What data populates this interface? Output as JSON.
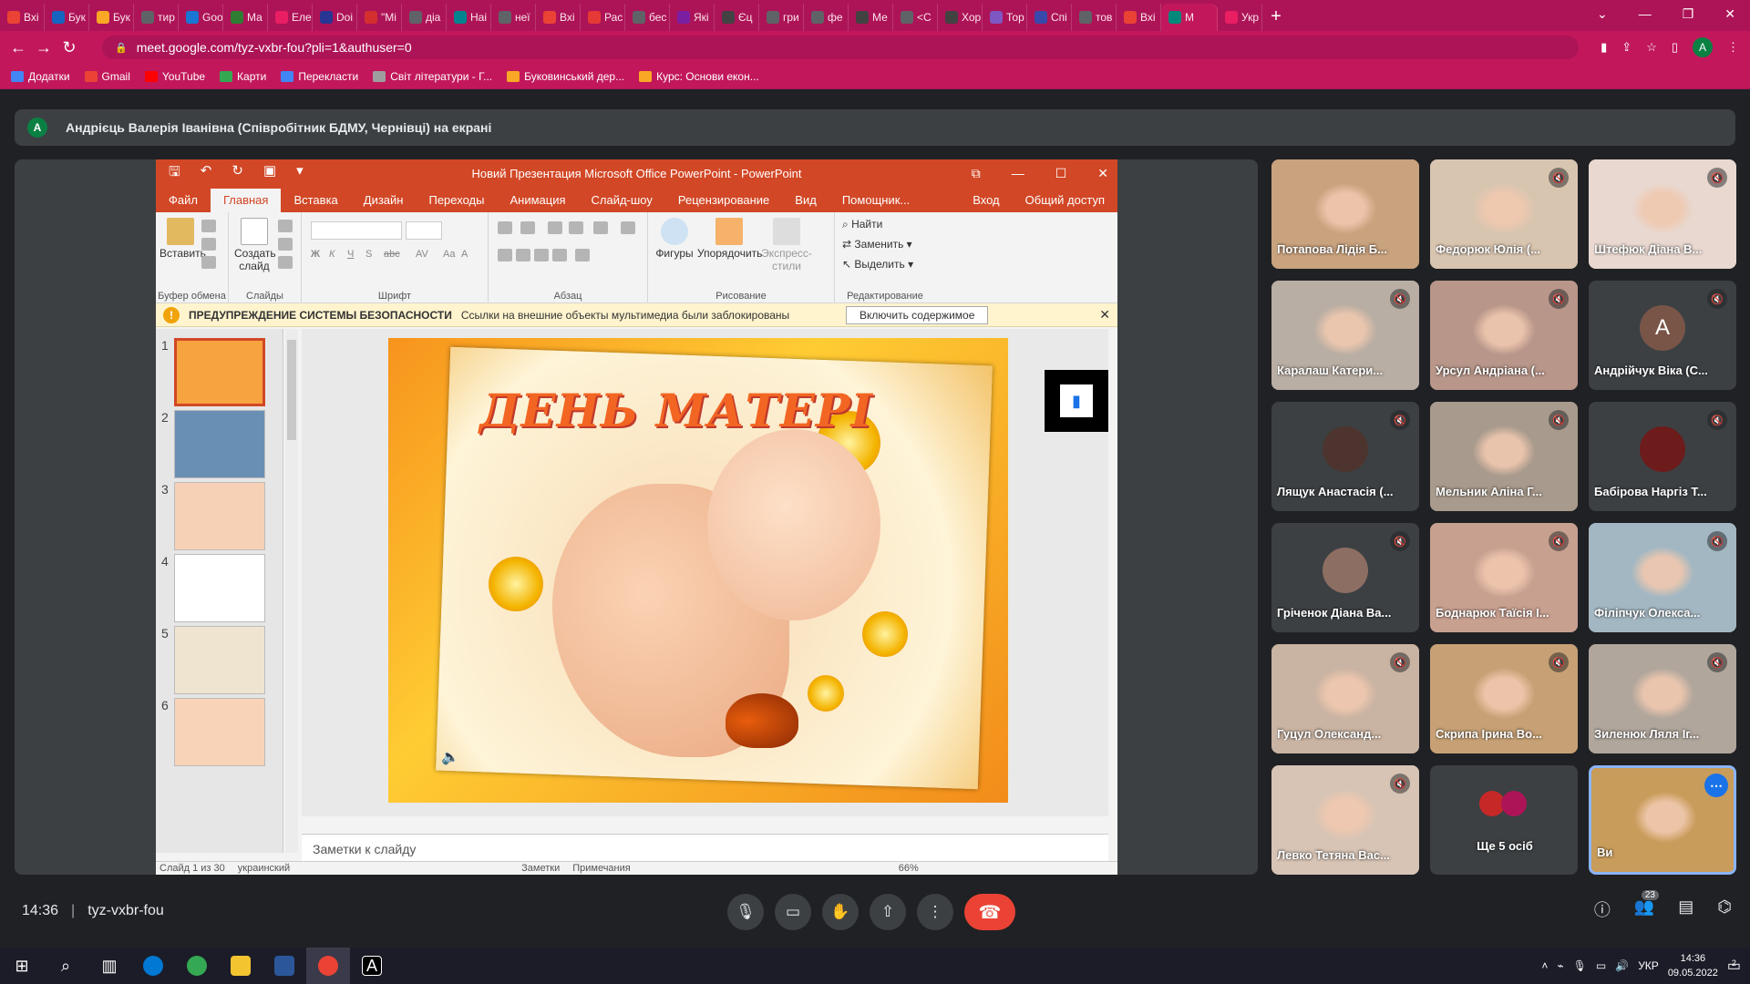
{
  "browser": {
    "tabs": [
      {
        "label": "Вхі",
        "color": "#ea4335"
      },
      {
        "label": "Бук",
        "color": "#1565c0"
      },
      {
        "label": "Бук",
        "color": "#f9a825"
      },
      {
        "label": "тир",
        "color": "#5f6368"
      },
      {
        "label": "Goo",
        "color": "#1976d2"
      },
      {
        "label": "Ма",
        "color": "#2e7d32"
      },
      {
        "label": "Еле",
        "color": "#e91e63"
      },
      {
        "label": "Doi",
        "color": "#283593"
      },
      {
        "label": "\"Мі",
        "color": "#d32f2f"
      },
      {
        "label": "діа",
        "color": "#5f6368"
      },
      {
        "label": "Наі",
        "color": "#00838f"
      },
      {
        "label": "неї",
        "color": "#5f6368"
      },
      {
        "label": "Вхі",
        "color": "#ea4335"
      },
      {
        "label": "Рас",
        "color": "#e53935"
      },
      {
        "label": "бес",
        "color": "#5f6368"
      },
      {
        "label": "Які",
        "color": "#7b1fa2"
      },
      {
        "label": "Єц",
        "color": "#424242"
      },
      {
        "label": "гри",
        "color": "#5f6368"
      },
      {
        "label": "фе",
        "color": "#5f6368"
      },
      {
        "label": "Ме",
        "color": "#424242"
      },
      {
        "label": "<С",
        "color": "#5f6368"
      },
      {
        "label": "Хор",
        "color": "#424242"
      },
      {
        "label": "Тор",
        "color": "#7e57c2"
      },
      {
        "label": "Спі",
        "color": "#3949ab"
      },
      {
        "label": "тов",
        "color": "#5f6368"
      },
      {
        "label": "Вхі",
        "color": "#ea4335"
      },
      {
        "label": "M",
        "color": "#00897b"
      },
      {
        "label": "Укр",
        "color": "#e91e63"
      }
    ],
    "new_tab": "+",
    "url": "meet.google.com/tyz-vxbr-fou?pli=1&authuser=0",
    "profile_initial": "A",
    "bookmarks": [
      {
        "label": "Додатки",
        "color": "#4285f4"
      },
      {
        "label": "Gmail",
        "color": "#ea4335"
      },
      {
        "label": "YouTube",
        "color": "#ff0000"
      },
      {
        "label": "Карти",
        "color": "#34a853"
      },
      {
        "label": "Перекласти",
        "color": "#4285f4"
      },
      {
        "label": "Світ літератури - Г...",
        "color": "#9e9e9e"
      },
      {
        "label": "Буковинський дер...",
        "color": "#f9a825"
      },
      {
        "label": "Курс: Основи екон...",
        "color": "#f9a825"
      }
    ]
  },
  "meet": {
    "presenter_initial": "A",
    "presenter_banner": "Андрієць Валерія Іванівна (Співробітник БДМУ, Чернівці) на екрані",
    "time": "14:36",
    "meeting_code": "tyz-vxbr-fou",
    "participant_count": "23",
    "participants": [
      {
        "name": "Потапова Лідія Б...",
        "bg": "#c9a27e",
        "muted": false
      },
      {
        "name": "Федорюк Юлія (...",
        "bg": "#d8c5b0",
        "muted": true
      },
      {
        "name": "Штефюк Діана В...",
        "bg": "#e8d8d0",
        "muted": true
      },
      {
        "name": "Каралаш Катери...",
        "bg": "#b9aea3",
        "muted": true
      },
      {
        "name": "Урсул Андріана (...",
        "bg": "#b8968a",
        "muted": true
      },
      {
        "name": "Андрійчук Віка (С...",
        "bg": "#3c4043",
        "muted": true,
        "initial": "A"
      },
      {
        "name": "Лящук Анастасія (...",
        "bg": "#3c4043",
        "muted": true,
        "avatar": "#4e342e"
      },
      {
        "name": "Мельник Аліна Г...",
        "bg": "#a89a8c",
        "muted": true
      },
      {
        "name": "Бабірова Наргіз Т...",
        "bg": "#3c4043",
        "muted": true,
        "avatar": "#6d1b1b"
      },
      {
        "name": "Гріченок Діана Ва...",
        "bg": "#3c4043",
        "muted": true,
        "avatar": "#8d6e63"
      },
      {
        "name": "Боднарюк Таїсія І...",
        "bg": "#c8a090",
        "muted": true
      },
      {
        "name": "Філіпчук Олекса...",
        "bg": "#a3b7c2",
        "muted": true
      },
      {
        "name": "Гуцул Олександ...",
        "bg": "#c9b3a2",
        "muted": true
      },
      {
        "name": "Скрипа Ірина Во...",
        "bg": "#c7a175",
        "muted": true
      },
      {
        "name": "Зиленюк Ляля Іг...",
        "bg": "#b0a69c",
        "muted": true
      },
      {
        "name": "Левко Тетяна Вас...",
        "bg": "#d7c4b5",
        "muted": true
      },
      {
        "name": "Ще 5 осіб",
        "bg": "#3c4043",
        "muted": false,
        "others": true
      },
      {
        "name": "Ви",
        "bg": "#c89c5a",
        "muted": false,
        "self": true
      }
    ]
  },
  "ppt": {
    "title": "Новий Презентация Microsoft Office PowerPoint - PowerPoint",
    "menu": [
      "Файл",
      "Главная",
      "Вставка",
      "Дизайн",
      "Переходы",
      "Анимация",
      "Слайд-шоу",
      "Рецензирование",
      "Вид",
      "Помощник...",
      "Вход",
      "Общий доступ"
    ],
    "groups": {
      "clipboard": "Буфер обмена",
      "slides": "Слайды",
      "font": "Шрифт",
      "paragraph": "Абзац",
      "drawing": "Рисование",
      "editing": "Редактирование"
    },
    "buttons": {
      "paste": "Вставить",
      "new_slide": "Создать слайд",
      "shapes": "Фигуры",
      "arrange": "Упорядочить",
      "quick_styles": "Экспресс-стили",
      "find": "Найти",
      "replace": "Заменить",
      "select": "Выделить"
    },
    "security": {
      "title": "ПРЕДУПРЕЖДЕНИЕ СИСТЕМЫ БЕЗОПАСНОСТИ",
      "message": "Ссылки на внешние объекты мультимедиа были заблокированы",
      "enable": "Включить содержимое"
    },
    "slide_title": "ДЕНЬ МАТЕРІ",
    "slide_numbers": [
      "1",
      "2",
      "3",
      "4",
      "5",
      "6"
    ],
    "notes_placeholder": "Заметки к слайду",
    "status": {
      "slide": "Слайд 1 из 30",
      "lang": "украинский",
      "notes": "Заметки",
      "comments": "Примечания",
      "zoom": "66%"
    }
  },
  "taskbar": {
    "lang": "УКР",
    "time": "14:36",
    "date": "09.05.2022",
    "notif_count": "2"
  }
}
